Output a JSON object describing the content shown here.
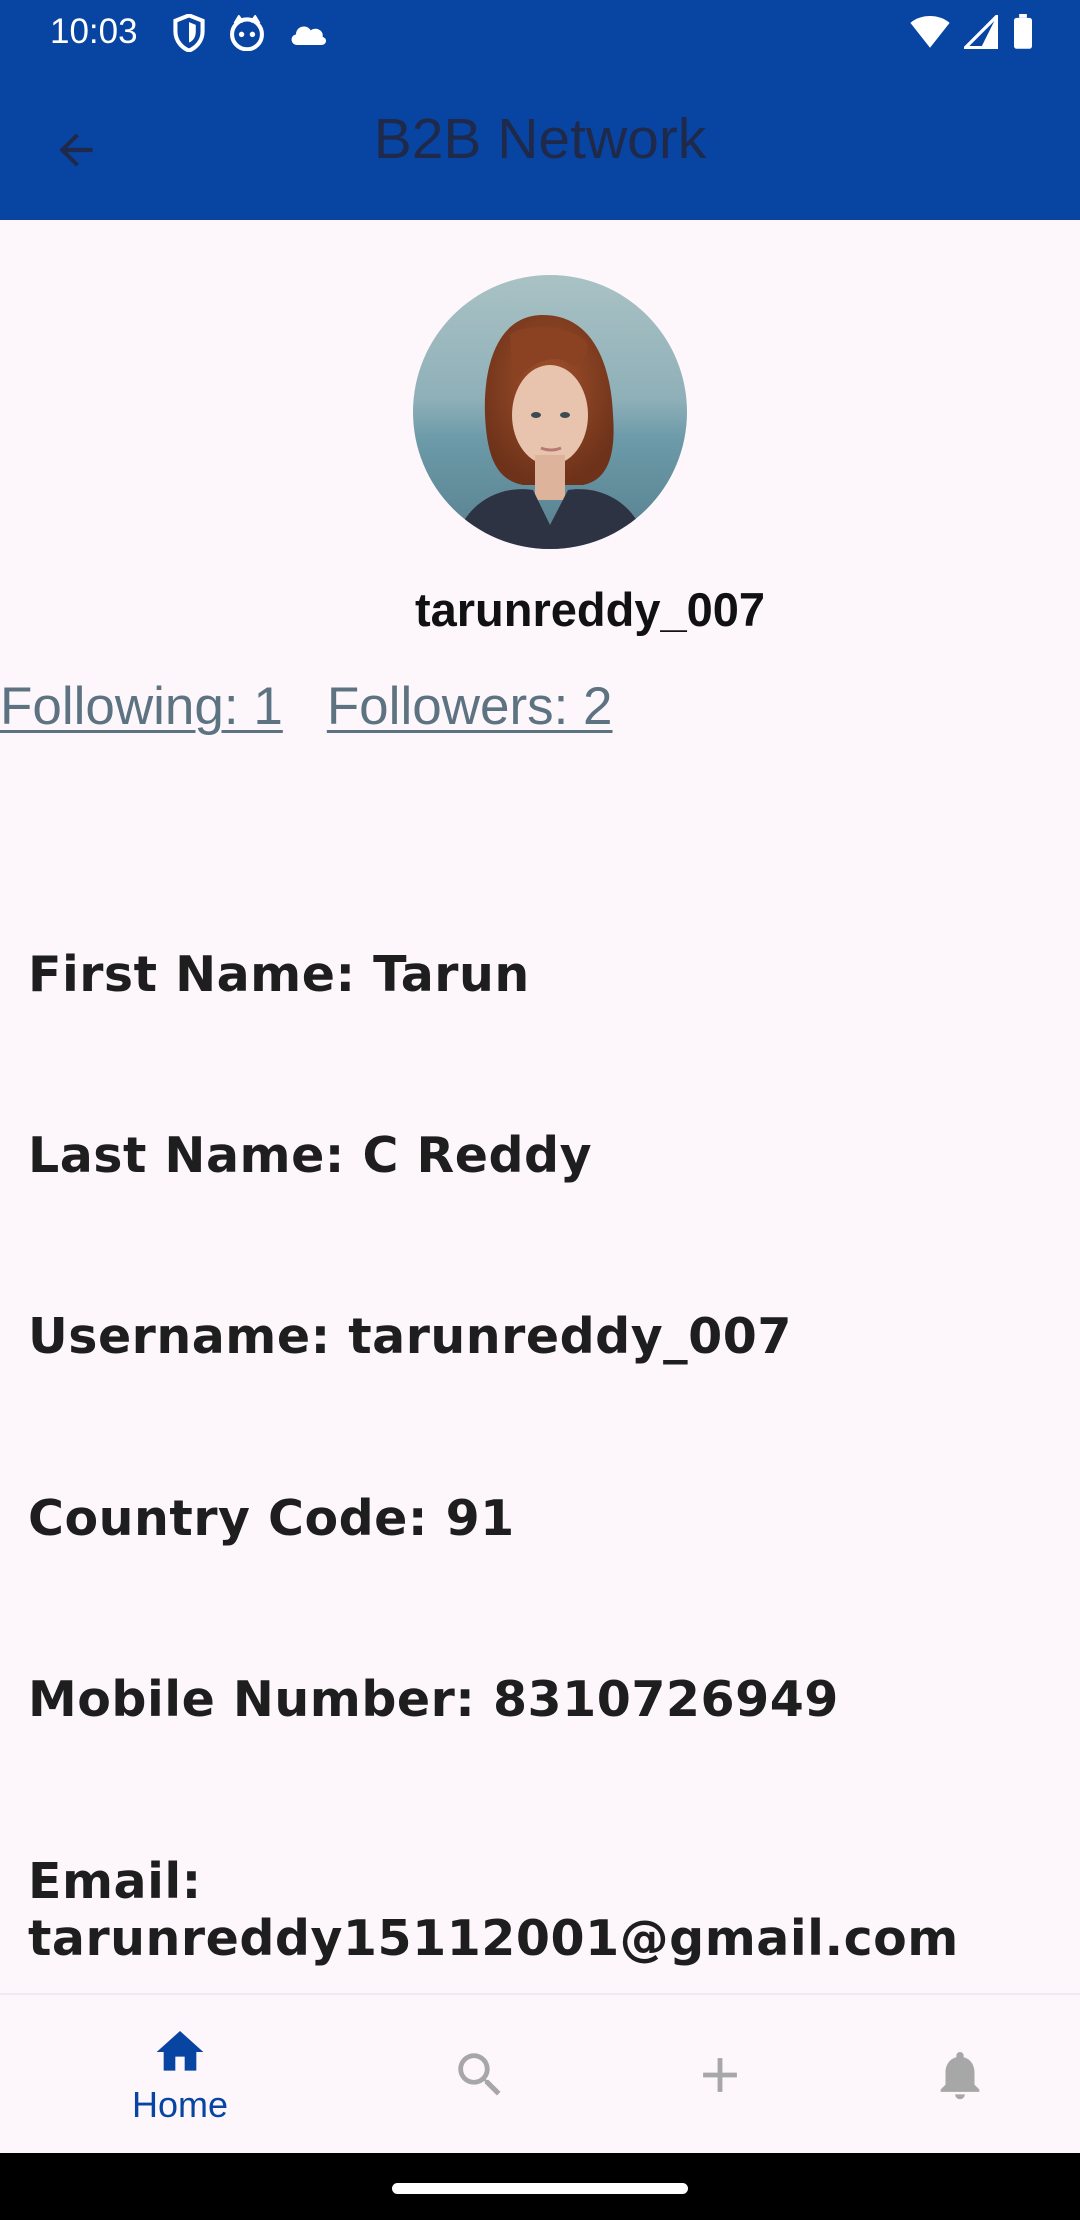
{
  "status_bar": {
    "time": "10:03",
    "left_icons": [
      "shield-icon",
      "cat-face-icon",
      "cloud-icon"
    ],
    "right_icons": [
      "wifi-icon",
      "signal-icon",
      "battery-icon"
    ]
  },
  "app_bar": {
    "title": "B2B Network",
    "back_icon": "arrow-back-icon"
  },
  "profile": {
    "username": "tarunreddy_007",
    "following": "Following: 1",
    "followers": "Followers: 2"
  },
  "details": [
    "First Name: Tarun",
    "Last Name: C Reddy",
    "Username: tarunreddy_007",
    "Country Code: 91",
    "Mobile Number: 8310726949",
    "Email: tarunreddy15112001@gmail.com"
  ],
  "bottom_nav": [
    {
      "label": "Home",
      "icon": "home-icon",
      "active": true
    },
    {
      "label": "",
      "icon": "search-icon",
      "active": false
    },
    {
      "label": "",
      "icon": "add-icon",
      "active": false
    },
    {
      "label": "",
      "icon": "bell-icon",
      "active": false
    }
  ],
  "colors": {
    "primary": "#0845a2",
    "background": "#fdf7fc",
    "link": "#5d7382",
    "inactive_icon": "#a7a7a7"
  }
}
